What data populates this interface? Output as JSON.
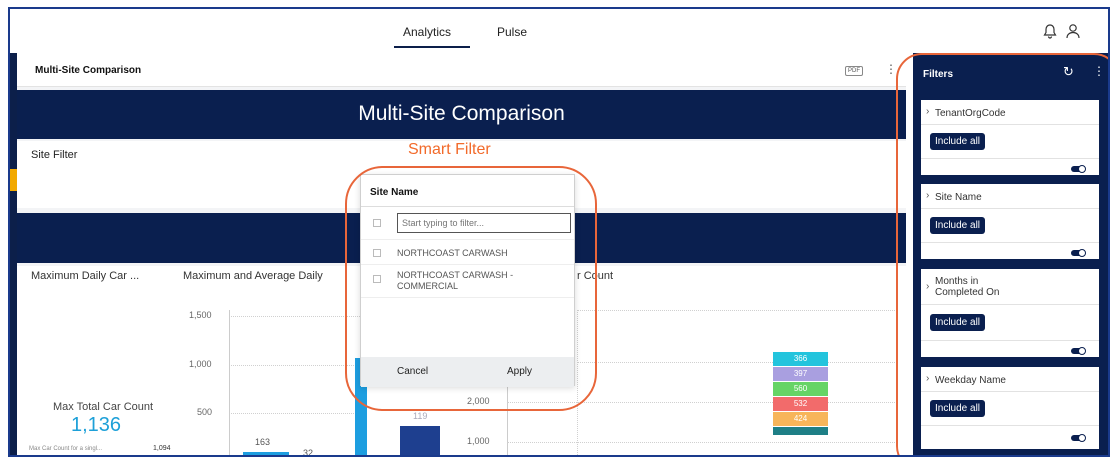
{
  "nav": {
    "tabs": [
      {
        "label": "Analytics"
      },
      {
        "label": "Pulse"
      }
    ]
  },
  "icons": {
    "bell": "bell-icon",
    "user": "user-icon",
    "reset": "refresh-icon",
    "more": "more-vertical-icon"
  },
  "dashboard": {
    "header_title": "Multi-Site Comparison",
    "pdf_label": "PDF",
    "banner_title": "Multi-Site Comparison",
    "site_filter_label": "Site Filter"
  },
  "charts": {
    "kpi_title": "Maximum Daily Car ...",
    "kpi_label": "Max  Total Car Count",
    "kpi_value": "1,136",
    "kpi_footer_label": "Max Car Count for a singl...",
    "kpi_footer_value": "1,094",
    "chart2_title": "Maximum and Average Daily",
    "chart3_title_fragment": "r Count"
  },
  "chart_data": [
    {
      "type": "bar",
      "title": "Maximum and Average Daily",
      "y_ticks": [
        "1,500",
        "1,000",
        "500"
      ],
      "ylim": [
        0,
        1500
      ],
      "data_labels": [
        "163",
        "32",
        "119"
      ]
    },
    {
      "type": "bar",
      "y_ticks": [
        "2,000",
        "1,000"
      ],
      "stack_values": [
        366,
        397,
        560,
        532,
        424
      ],
      "stack_colors": [
        "#23c4dd",
        "#a99fe0",
        "#66d466",
        "#f26b6b",
        "#f7b55a"
      ]
    }
  ],
  "smart_filter": {
    "annotation": "Smart Filter",
    "title": "Site Name",
    "search_placeholder": "Start typing to filter...",
    "options": [
      "NORTHCOAST CARWASH",
      "NORTHCOAST CARWASH - COMMERCIAL"
    ],
    "cancel_label": "Cancel",
    "apply_label": "Apply"
  },
  "filters_panel": {
    "title": "Filters",
    "cards": [
      {
        "title": "TenantOrgCode",
        "button": "Include all"
      },
      {
        "title": "Site Name",
        "button": "Include all"
      },
      {
        "title": "Months in\nCompleted On",
        "button": "Include all"
      },
      {
        "title": "Weekday Name",
        "button": "Include all"
      }
    ]
  }
}
